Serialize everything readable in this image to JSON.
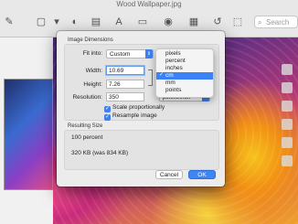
{
  "window": {
    "title": "Wood Wallpaper.jpg"
  },
  "toolbar": {
    "search_placeholder": "Search"
  },
  "dialog": {
    "image_dimensions_title": "Image Dimensions",
    "fit_into_label": "Fit into:",
    "fit_into_value": "Custom",
    "width_label": "Width:",
    "width_value": "10.69",
    "height_label": "Height:",
    "height_value": "7.26",
    "resolution_label": "Resolution:",
    "resolution_value": "350",
    "resolution_unit": "pixels/inch",
    "scale_proportionally": "Scale proportionally",
    "resample_image": "Resample image",
    "resulting_size_title": "Resulting Size",
    "result_percent": "100 percent",
    "result_size": "320 KB (was 834 KB)",
    "cancel_label": "Cancel",
    "ok_label": "OK"
  },
  "unit_menu": {
    "items": [
      "pixels",
      "percent",
      "inches",
      "cm",
      "mm",
      "points"
    ],
    "selected": "cm"
  },
  "colors": {
    "accent": "#3b82f5",
    "dialog_bg": "#ececec"
  },
  "icons": [
    "pencil-icon",
    "shapes-icon",
    "text-icon",
    "adjust-icon",
    "share-icon",
    "rotate-icon",
    "markup-icon",
    "sidebar-icon",
    "search-icon"
  ]
}
